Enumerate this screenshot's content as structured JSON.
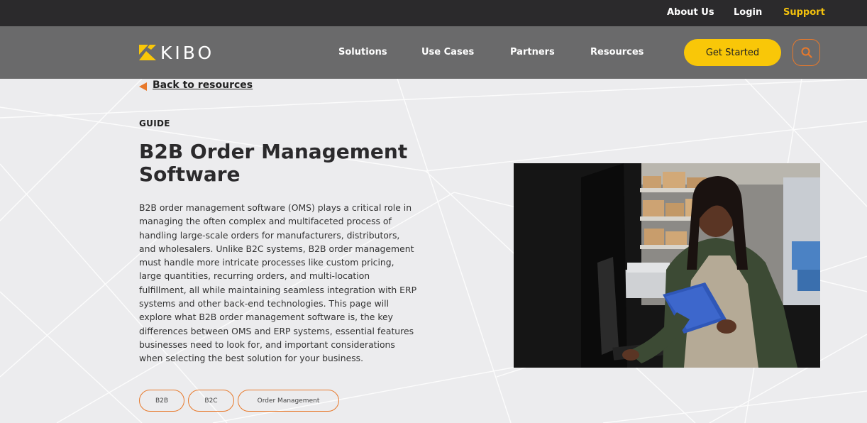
{
  "topbar": {
    "links": [
      {
        "label": "About Us"
      },
      {
        "label": "Login"
      },
      {
        "label": "Support"
      }
    ]
  },
  "nav": {
    "logo_text": "KIBO",
    "items": [
      {
        "label": "Solutions"
      },
      {
        "label": "Use Cases"
      },
      {
        "label": "Partners"
      },
      {
        "label": "Resources"
      }
    ],
    "cta_label": "Get Started",
    "search_icon": "search-icon"
  },
  "hero": {
    "back_label": "Back to resources",
    "eyebrow": "GUIDE",
    "title": "B2B Order Management Software",
    "body": "B2B order management software (OMS) plays a critical role in managing the often complex and multifaceted process of handling large-scale orders for manufacturers, distributors, and wholesalers. Unlike B2C systems, B2B order management must handle more intricate processes like custom pricing, large quantities, recurring orders, and multi-location fulfillment, all while maintaining seamless integration with ERP systems and other back-end technologies. This page will explore what B2B order management software is, the key differences between OMS and ERP systems, essential features businesses need to look for, and important considerations when selecting the best solution for your business.",
    "tags": [
      {
        "label": "B2B"
      },
      {
        "label": "B2C"
      },
      {
        "label": "Order Management"
      }
    ]
  },
  "colors": {
    "accent_orange": "#e8792b",
    "cta_yellow": "#f9c708",
    "support_yellow": "#f4c20d",
    "topbar_bg": "#2b2a2c",
    "navbar_bg": "#6a6a6b"
  }
}
